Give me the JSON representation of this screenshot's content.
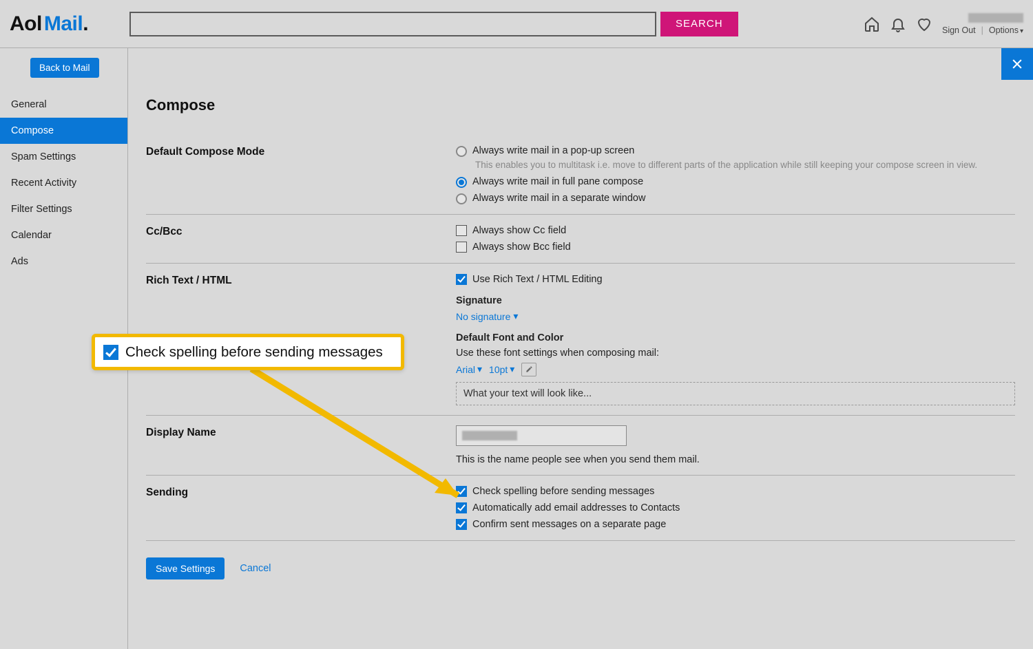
{
  "header": {
    "logo_aol": "Aol",
    "logo_mail": "Mail",
    "logo_dot": ".",
    "search_button": "SEARCH",
    "sign_out": "Sign Out",
    "options": "Options"
  },
  "sidebar": {
    "back_button": "Back to Mail",
    "items": [
      "General",
      "Compose",
      "Spam Settings",
      "Recent Activity",
      "Filter Settings",
      "Calendar",
      "Ads"
    ],
    "active_index": 1
  },
  "page": {
    "title": "Compose",
    "sections": {
      "compose_mode": {
        "label": "Default Compose Mode",
        "options": [
          {
            "label": "Always write mail in a pop-up screen",
            "selected": false
          },
          {
            "label": "Always write mail in full pane compose",
            "selected": true
          },
          {
            "label": "Always write mail in a separate window",
            "selected": false
          }
        ],
        "popup_hint": "This enables you to multitask i.e. move to different parts of the application while still keeping your compose screen in view."
      },
      "cc_bcc": {
        "label": "Cc/Bcc",
        "cc": {
          "label": "Always show Cc field",
          "checked": false
        },
        "bcc": {
          "label": "Always show Bcc field",
          "checked": false
        }
      },
      "rich_text": {
        "label": "Rich Text / HTML",
        "use_rich": {
          "label": "Use Rich Text / HTML Editing",
          "checked": true
        },
        "signature_heading": "Signature",
        "signature_value": "No signature",
        "font_heading": "Default Font and Color",
        "font_hint": "Use these font settings when composing mail:",
        "font_family": "Arial",
        "font_size": "10pt",
        "preview_text": "What your text will look like..."
      },
      "display_name": {
        "label": "Display Name",
        "hint": "This is the name people see when you send them mail."
      },
      "sending": {
        "label": "Sending",
        "spell": {
          "label": "Check spelling before sending messages",
          "checked": true
        },
        "contacts": {
          "label": "Automatically add email addresses to Contacts",
          "checked": true
        },
        "confirm": {
          "label": "Confirm sent messages on a separate page",
          "checked": true
        }
      }
    },
    "save_button": "Save Settings",
    "cancel_link": "Cancel"
  },
  "callout": {
    "label": "Check spelling before sending messages"
  }
}
